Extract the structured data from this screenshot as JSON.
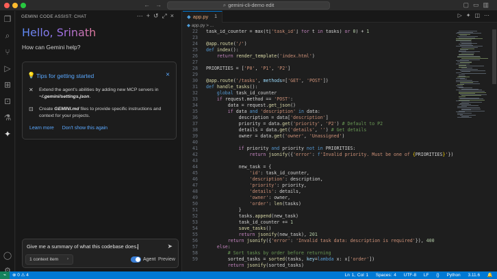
{
  "window": {
    "title": "gemini-cli-demo edit"
  },
  "activity_bar": {
    "icons": [
      "files-icon",
      "search-icon",
      "source-control-icon",
      "run-debug-icon",
      "extensions-icon",
      "remote-explorer-icon",
      "testing-icon",
      "gemini-icon",
      "account-icon",
      "settings-gear-icon"
    ]
  },
  "chat_panel": {
    "header": "GEMINI CODE ASSIST: CHAT",
    "greeting": "Hello, Srinath",
    "subtitle": "How can Gemini help?",
    "tips": {
      "title": "Tips for getting started",
      "tip1_a": "Extend the agent's abilities by adding new MCP servers in ",
      "tip1_b": "~/.gemini/settings.json",
      "tip1_c": ".",
      "tip2_a": "Create ",
      "tip2_b": "GEMINI.md",
      "tip2_c": " files to provide specific instructions and context for your projects.",
      "learn_more": "Learn more",
      "dont_show": "Don't show this again"
    },
    "input": {
      "value": "Give me a summary of what this codebase does."
    },
    "context_button": "1 context item",
    "agent_label": "Agent",
    "preview_label": "Preview"
  },
  "editor": {
    "tab": {
      "filename": "app.py",
      "modified_count": "1"
    },
    "breadcrumb": {
      "file": "app.py",
      "trail": "> ..."
    },
    "line_numbers": [
      "22",
      "23",
      "24",
      "25",
      "26",
      "27",
      "28",
      "29",
      "30",
      "31",
      "32",
      "33",
      "34",
      "35",
      "36",
      "37",
      "38",
      "39",
      "40",
      "41",
      "42",
      "43",
      "44",
      "45",
      "46",
      "47",
      "48",
      "49",
      "50",
      "51",
      "52",
      "53",
      "54",
      "55",
      "56",
      "57",
      "58",
      "59"
    ]
  },
  "status_bar": {
    "problems": "⊗ 0 ⚠ 4",
    "position": "Ln 1, Col 1",
    "spaces": "Spaces: 4",
    "encoding": "UTF-8",
    "eol": "LF",
    "language": "Python",
    "version": "3.11.6"
  },
  "colors": {
    "accent": "#0078d4",
    "link": "#5aa8ff",
    "toggle_on": "#3b7fd6"
  }
}
